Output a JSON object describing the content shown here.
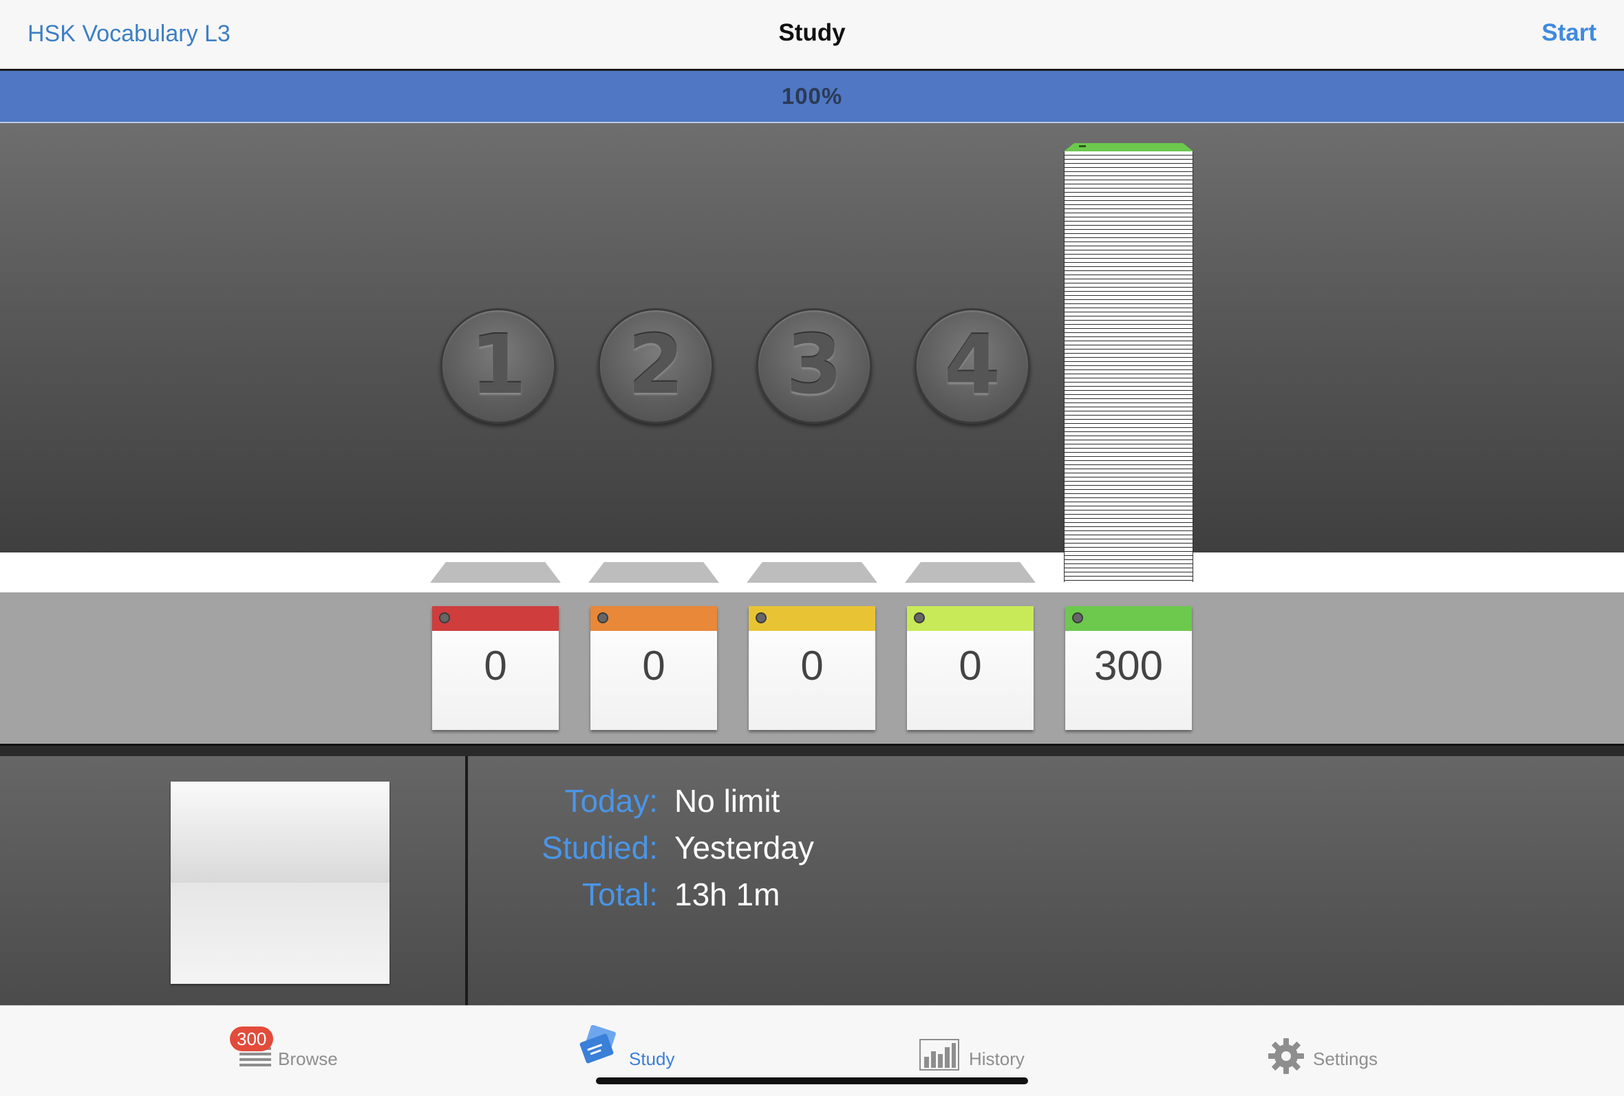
{
  "nav": {
    "back_label": "HSK Vocabulary L3",
    "title": "Study",
    "action_label": "Start"
  },
  "progress": {
    "label": "100%",
    "value_percent": 100,
    "fill_color": "#4f77c3"
  },
  "boxes": [
    {
      "number": "1",
      "count": "0",
      "color": "#cf3d3d"
    },
    {
      "number": "2",
      "count": "0",
      "color": "#e88838"
    },
    {
      "number": "3",
      "count": "0",
      "color": "#e8c434"
    },
    {
      "number": "4",
      "count": "0",
      "color": "#c8ea58"
    }
  ],
  "pool": {
    "count": "300",
    "color": "#6cc94d"
  },
  "stats": [
    {
      "label": "Today:",
      "value": "No limit"
    },
    {
      "label": "Studied:",
      "value": "Yesterday"
    },
    {
      "label": "Total:",
      "value": "13h 1m"
    }
  ],
  "tabs": [
    {
      "label": "Browse",
      "icon": "list-icon",
      "badge": "300",
      "active": false
    },
    {
      "label": "Study",
      "icon": "flashcards-icon",
      "active": true
    },
    {
      "label": "History",
      "icon": "bar-chart-icon",
      "active": false
    },
    {
      "label": "Settings",
      "icon": "gear-icon",
      "active": false
    }
  ],
  "colors": {
    "accent": "#3f8ae0",
    "stat_label": "#4a95e8"
  }
}
